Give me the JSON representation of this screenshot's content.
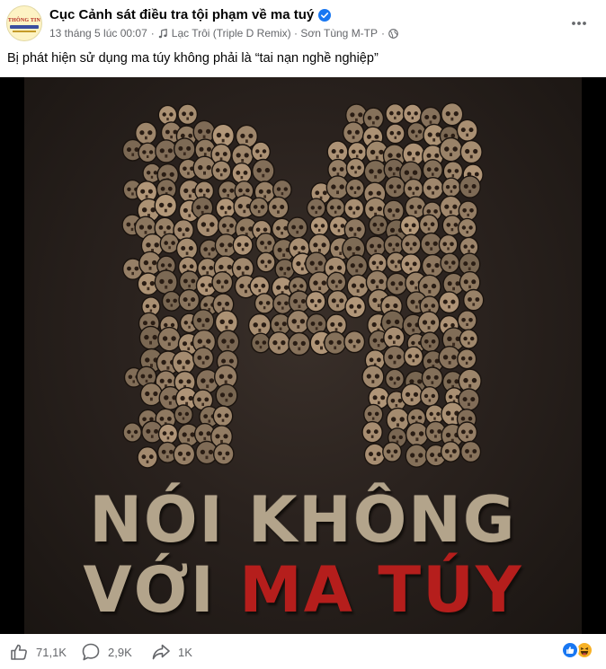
{
  "post": {
    "page_name": "Cục Cảnh sát điều tra tội phạm về ma tuý",
    "avatar_text": "THÔNG TIN",
    "date": "13 tháng 5 lúc 00:07",
    "separator": "·",
    "song": "Lạc Trôi (Triple D Remix) · Sơn Tùng M-TP",
    "privacy_icon": "globe-icon",
    "caption": "Bị phát hiện sử dụng ma túy không phải là “tai nạn nghề nghiệp”"
  },
  "poster": {
    "big_letter": "M",
    "line1": "NÓI KHÔNG",
    "line2_prefix": "VỚI ",
    "line2_highlight": "MA TÚY",
    "highlight_color": "#b51e1c"
  },
  "actions": {
    "likes": "71,1K",
    "comments": "2,9K",
    "shares": "1K"
  },
  "icons": {
    "more": "more-options-icon",
    "mute": "speaker-muted-icon",
    "like": "thumbs-up-icon",
    "comment": "comment-bubble-icon",
    "share": "share-arrow-icon"
  },
  "colors": {
    "verified": "#1877f2",
    "meta_text": "#65676b",
    "like_reaction": "#1877f2",
    "haha_reaction": "#f7b125"
  }
}
